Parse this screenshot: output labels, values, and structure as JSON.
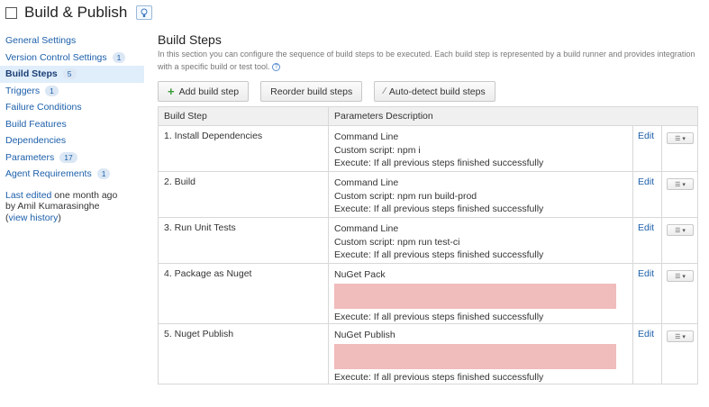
{
  "header": {
    "title": "Build & Publish"
  },
  "sidebar": {
    "items": [
      {
        "label": "General Settings",
        "count": null
      },
      {
        "label": "Version Control Settings",
        "count": "1"
      },
      {
        "label": "Build Steps",
        "count": "5",
        "active": true
      },
      {
        "label": "Triggers",
        "count": "1"
      },
      {
        "label": "Failure Conditions",
        "count": null
      },
      {
        "label": "Build Features",
        "count": null
      },
      {
        "label": "Dependencies",
        "count": null
      },
      {
        "label": "Parameters",
        "count": "17"
      },
      {
        "label": "Agent Requirements",
        "count": "1"
      }
    ],
    "edited": {
      "link": "Last edited",
      "when": " one month ago",
      "by": "by Amil Kumarasinghe",
      "history_open": "(",
      "history_link": "view history",
      "history_close": ")"
    }
  },
  "main": {
    "title": "Build Steps",
    "description": "In this section you can configure the sequence of build steps to be executed. Each build step is represented by a build runner and provides integration with a specific build or test tool.",
    "help_icon": "question-circle-icon",
    "buttons": {
      "add": "Add build step",
      "reorder": "Reorder build steps",
      "autodetect": "Auto-detect build steps"
    },
    "table": {
      "headers": [
        "Build Step",
        "Parameters Description"
      ],
      "edit_label": "Edit",
      "rows": [
        {
          "step": "1. Install Dependencies",
          "params": [
            "Command Line",
            "Custom script: npm i",
            "Execute: If all previous steps finished successfully"
          ]
        },
        {
          "step": "2. Build",
          "params": [
            "Command Line",
            "Custom script: npm run build-prod",
            "Execute: If all previous steps finished successfully"
          ]
        },
        {
          "step": "3. Run Unit Tests",
          "params": [
            "Command Line",
            "Custom script: npm run test-ci",
            "Execute: If all previous steps finished successfully"
          ]
        },
        {
          "step": "4. Package as Nuget",
          "params": [
            "NuGet Pack",
            "Execute: If all previous steps finished successfully"
          ],
          "redacted": true
        },
        {
          "step": "5. Nuget Publish",
          "params": [
            "NuGet Publish",
            "Execute: If all previous steps finished successfully"
          ],
          "redacted": true
        }
      ]
    }
  }
}
